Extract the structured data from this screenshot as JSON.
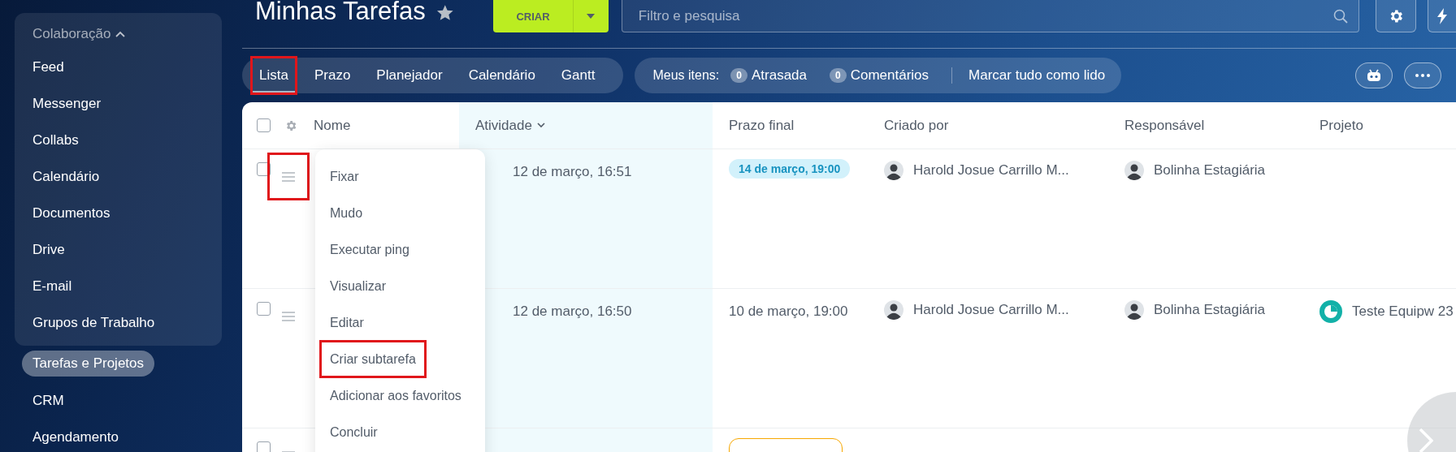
{
  "sidebar": {
    "group": {
      "label": "Colaboração",
      "expanded": true,
      "items": [
        {
          "label": "Feed",
          "selected": false
        },
        {
          "label": "Messenger",
          "selected": false
        },
        {
          "label": "Collabs",
          "selected": false
        },
        {
          "label": "Calendário",
          "selected": false
        },
        {
          "label": "Documentos",
          "selected": false
        },
        {
          "label": "Drive",
          "selected": false
        },
        {
          "label": "E-mail",
          "selected": false
        },
        {
          "label": "Grupos de Trabalho",
          "selected": false
        }
      ]
    },
    "items": [
      {
        "label": "Tarefas e Projetos",
        "selected": true
      },
      {
        "label": "CRM",
        "selected": false
      },
      {
        "label": "Agendamento",
        "selected": false
      }
    ]
  },
  "header": {
    "title": "Minhas Tarefas",
    "create_button": "CRIAR",
    "search": {
      "placeholder": "Filtro e pesquisa"
    }
  },
  "view_tabs": [
    {
      "label": "Lista",
      "selected": true,
      "highlighted": true
    },
    {
      "label": "Prazo",
      "selected": false,
      "highlighted": false
    },
    {
      "label": "Planejador",
      "selected": false,
      "highlighted": false
    },
    {
      "label": "Calendário",
      "selected": false,
      "highlighted": false
    },
    {
      "label": "Gantt",
      "selected": false,
      "highlighted": false
    }
  ],
  "my_items": {
    "label": "Meus itens:",
    "counters": [
      {
        "count": "0",
        "label": "Atrasada"
      },
      {
        "count": "0",
        "label": "Comentários"
      }
    ],
    "action": "Marcar tudo como lido"
  },
  "table": {
    "all_checked": false,
    "columns": [
      {
        "label": "Nome",
        "sorted": false
      },
      {
        "label": "Atividade",
        "sorted": true
      },
      {
        "label": "Prazo final",
        "sorted": false
      },
      {
        "label": "Criado por",
        "sorted": false
      },
      {
        "label": "Responsável",
        "sorted": false
      },
      {
        "label": "Projeto",
        "sorted": false
      }
    ],
    "rows": [
      {
        "checked": false,
        "menu_highlighted": true,
        "activity": "12 de março, 16:51",
        "deadline": {
          "kind": "badge",
          "text": "14 de março, 19:00"
        },
        "created_by": "Harold Josue Carrillo M...",
        "assignee": "Bolinha Estagiária"
      },
      {
        "checked": false,
        "menu_highlighted": false,
        "activity": "12 de março, 16:50",
        "deadline": {
          "kind": "text",
          "text": "10 de março, 19:00"
        },
        "created_by": "Harold Josue Carrillo M...",
        "assignee": "Bolinha Estagiária",
        "project": "Teste Equipw 23"
      },
      {
        "checked": false,
        "menu_highlighted": false,
        "deadline": {
          "kind": "pending"
        }
      }
    ]
  },
  "context_menu": {
    "items": [
      {
        "label": "Fixar",
        "highlighted": false
      },
      {
        "label": "Mudo",
        "highlighted": false
      },
      {
        "label": "Executar ping",
        "highlighted": false
      },
      {
        "label": "Visualizar",
        "highlighted": false
      },
      {
        "label": "Editar",
        "highlighted": false
      },
      {
        "label": "Criar subtarefa",
        "highlighted": true
      },
      {
        "label": "Adicionar aos favoritos",
        "highlighted": false
      },
      {
        "label": "Concluir",
        "highlighted": false
      }
    ]
  }
}
